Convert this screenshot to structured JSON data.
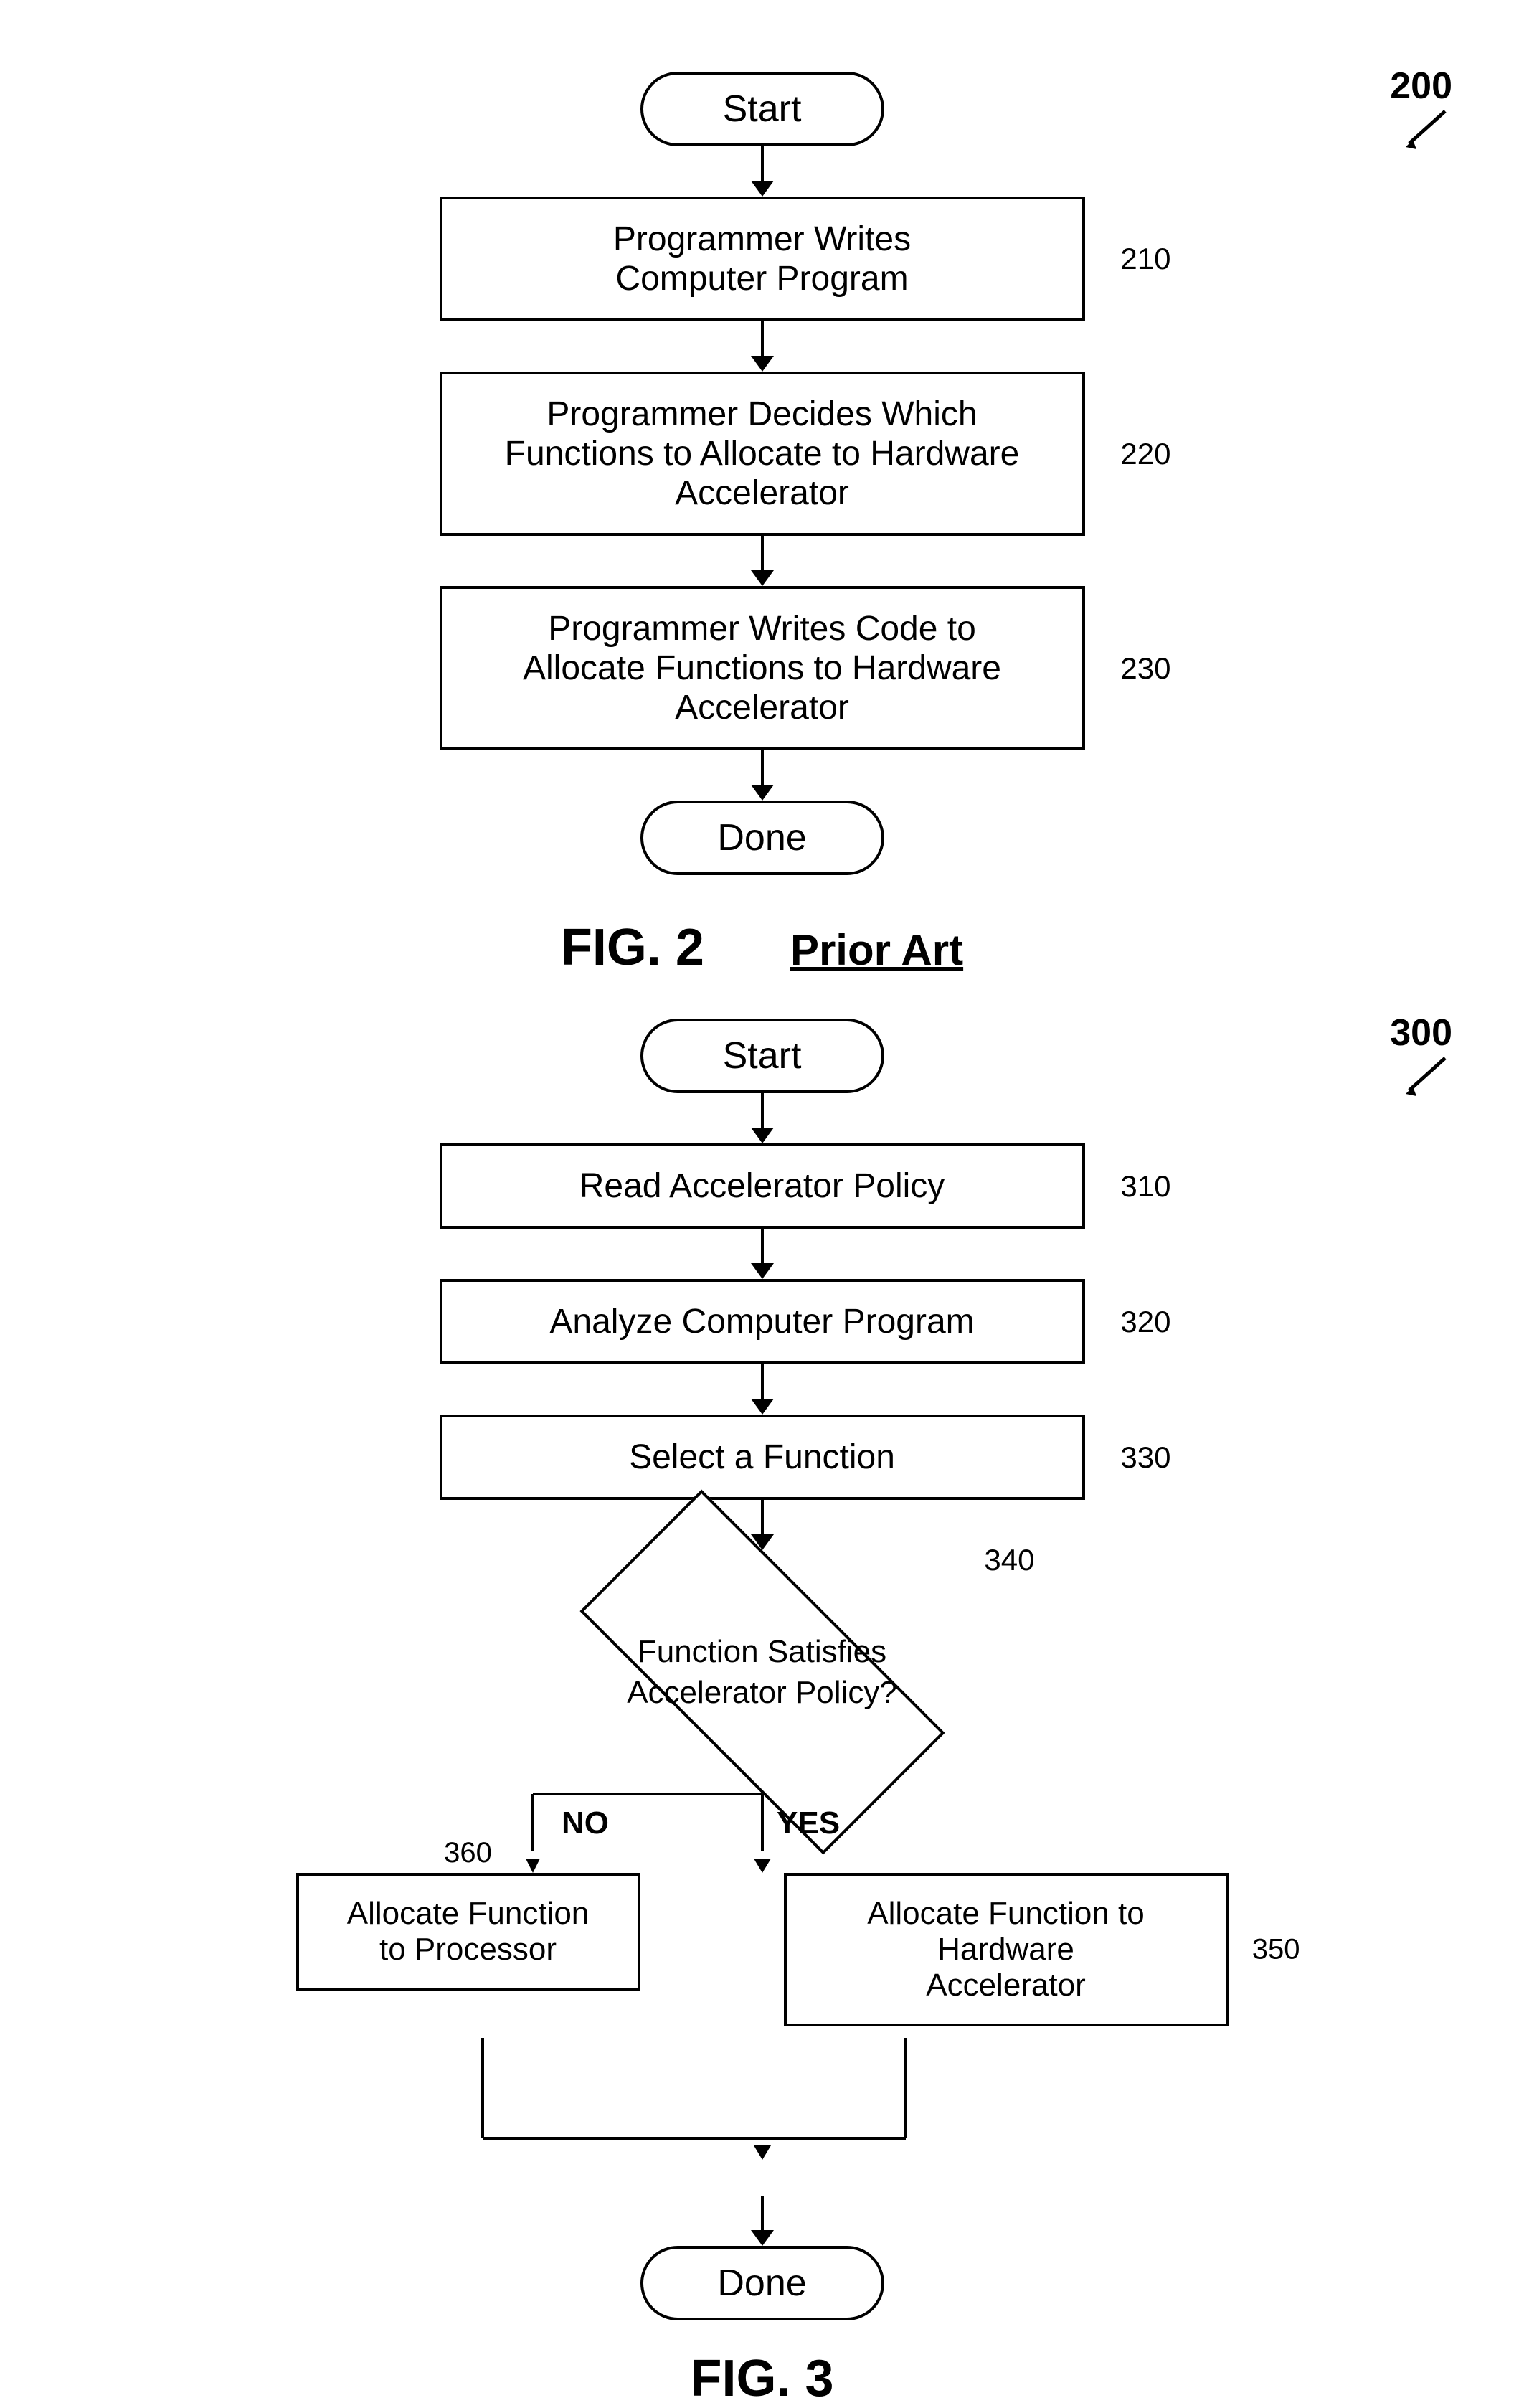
{
  "fig2": {
    "label": "200",
    "fig_title": "FIG. 2",
    "prior_art": "Prior Art",
    "start_label": "Start",
    "done_label": "Done",
    "steps": [
      {
        "id": "210",
        "text": "Programmer Writes\nComputer Program",
        "num": "210"
      },
      {
        "id": "220",
        "text": "Programmer Decides Which\nFunctions to Allocate to Hardware\nAccelerator",
        "num": "220"
      },
      {
        "id": "230",
        "text": "Programmer Writes Code to\nAllocate Functions to Hardware\nAccelerator",
        "num": "230"
      }
    ]
  },
  "fig3": {
    "label": "300",
    "fig_title": "FIG. 3",
    "start_label": "Start",
    "done_label": "Done",
    "steps": [
      {
        "id": "310",
        "text": "Read Accelerator Policy",
        "num": "310"
      },
      {
        "id": "320",
        "text": "Analyze Computer Program",
        "num": "320"
      },
      {
        "id": "330",
        "text": "Select a Function",
        "num": "330"
      }
    ],
    "diamond": {
      "id": "340",
      "num": "340",
      "text": "Function Satisfies\nAccelerator Policy?",
      "no_label": "NO",
      "yes_label": "YES"
    },
    "left_branch": {
      "id": "360",
      "num": "360",
      "text": "Allocate Function\nto Processor"
    },
    "right_branch": {
      "id": "350",
      "num": "350",
      "text": "Allocate Function to Hardware\nAccelerator"
    }
  }
}
